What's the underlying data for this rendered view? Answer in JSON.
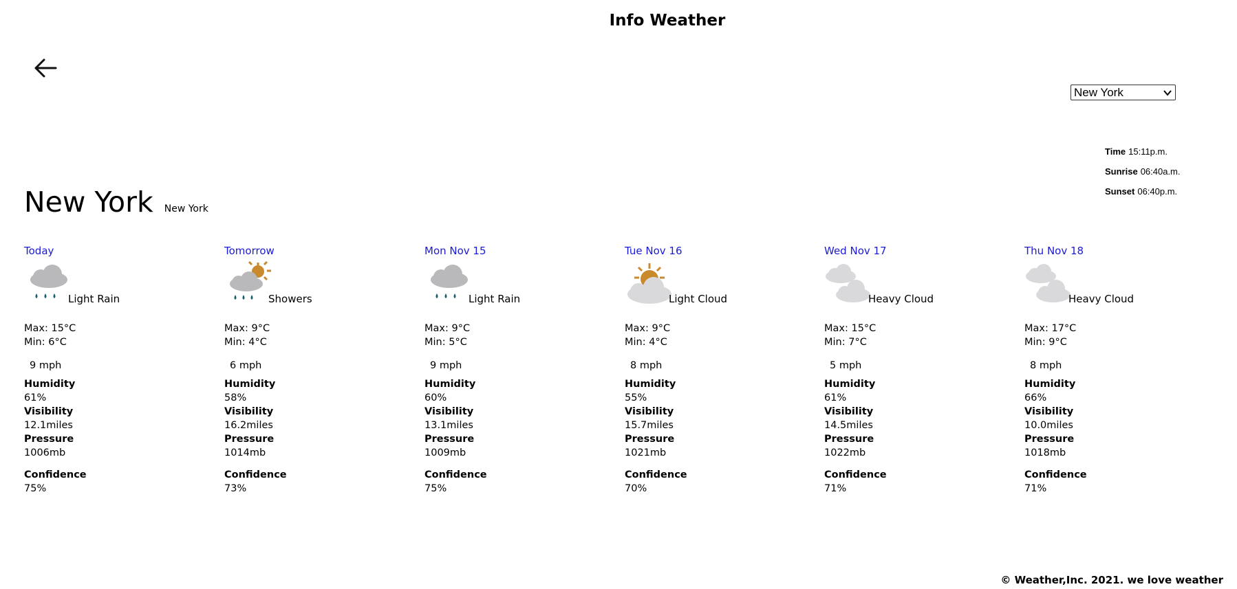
{
  "header": {
    "title": "Info Weather"
  },
  "location_select": {
    "selected": "New York"
  },
  "sun_times": {
    "time_label": "Time",
    "time_value": "15:11p.m.",
    "sunrise_label": "Sunrise",
    "sunrise_value": "06:40a.m.",
    "sunset_label": "Sunset",
    "sunset_value": "06:40p.m."
  },
  "location": {
    "city": "New York",
    "region": "New York"
  },
  "labels": {
    "humidity": "Humidity",
    "visibility": "Visibility",
    "pressure": "Pressure",
    "confidence": "Confidence"
  },
  "days": [
    {
      "label": "Today",
      "icon": "light-rain-icon",
      "condition": "Light Rain",
      "max": "Max: 15°C",
      "min": "Min: 6°C",
      "wind": "9 mph",
      "humidity": "61%",
      "visibility": "12.1miles",
      "pressure": "1006mb",
      "confidence": "75%"
    },
    {
      "label": "Tomorrow",
      "icon": "showers-icon",
      "condition": "Showers",
      "max": "Max: 9°C",
      "min": "Min: 4°C",
      "wind": "6 mph",
      "humidity": "58%",
      "visibility": "16.2miles",
      "pressure": "1014mb",
      "confidence": "73%"
    },
    {
      "label": "Mon Nov 15",
      "icon": "light-rain-icon",
      "condition": "Light Rain",
      "max": "Max: 9°C",
      "min": "Min: 5°C",
      "wind": "9 mph",
      "humidity": "60%",
      "visibility": "13.1miles",
      "pressure": "1009mb",
      "confidence": "75%"
    },
    {
      "label": "Tue Nov 16",
      "icon": "light-cloud-icon",
      "condition": "Light Cloud",
      "max": "Max: 9°C",
      "min": "Min: 4°C",
      "wind": "8 mph",
      "humidity": "55%",
      "visibility": "15.7miles",
      "pressure": "1021mb",
      "confidence": "70%"
    },
    {
      "label": "Wed Nov 17",
      "icon": "heavy-cloud-icon",
      "condition": "Heavy Cloud",
      "max": "Max: 15°C",
      "min": "Min: 7°C",
      "wind": "5 mph",
      "humidity": "61%",
      "visibility": "14.5miles",
      "pressure": "1022mb",
      "confidence": "71%"
    },
    {
      "label": "Thu Nov 18",
      "icon": "heavy-cloud-icon",
      "condition": "Heavy Cloud",
      "max": "Max: 17°C",
      "min": "Min: 9°C",
      "wind": "8 mph",
      "humidity": "66%",
      "visibility": "10.0miles",
      "pressure": "1018mb",
      "confidence": "71%"
    }
  ],
  "footer": {
    "text": "© Weather,Inc. 2021. we love weather"
  },
  "colors": {
    "day_label": "#1a1ad8",
    "cloud": "#b9b9bb",
    "light_cloud": "#d9d9db",
    "rain": "#17606e",
    "sun": "#c98a2e"
  }
}
